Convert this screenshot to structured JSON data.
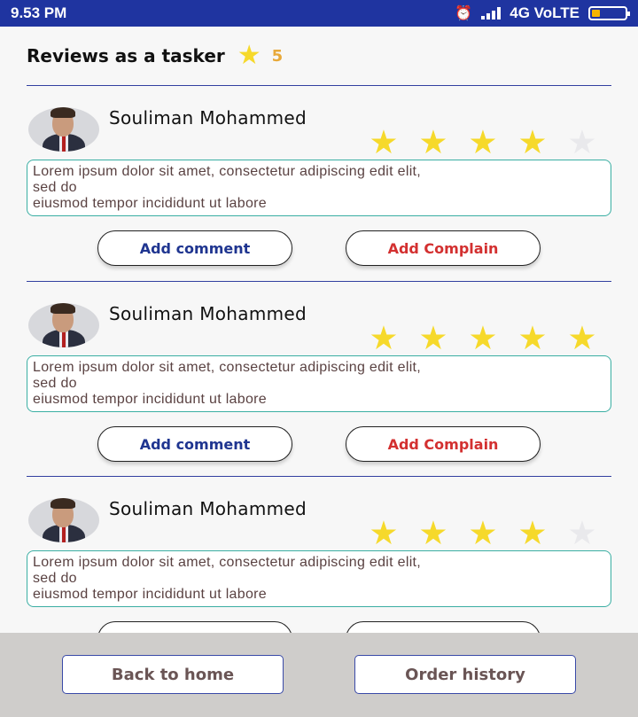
{
  "status_bar": {
    "time": "9.53 PM",
    "network": "4G VoLTE"
  },
  "header": {
    "title": "Reviews as a tasker",
    "rating": "5"
  },
  "reviews": [
    {
      "name": "Souliman Mohammed",
      "stars": 4,
      "comment_line1": "Lorem ipsum dolor sit amet, consectetur adipiscing edit elit,",
      "comment_line2": "sed do",
      "comment_line3": "eiusmod tempor incididunt ut labore",
      "comment_button": "Add comment",
      "complain_button": "Add Complain"
    },
    {
      "name": "Souliman Mohammed",
      "stars": 5,
      "comment_line1": "Lorem ipsum dolor sit amet, consectetur adipiscing edit elit,",
      "comment_line2": "sed do",
      "comment_line3": "eiusmod tempor incididunt ut labore",
      "comment_button": "Add comment",
      "complain_button": "Add Complain"
    },
    {
      "name": "Souliman Mohammed",
      "stars": 4,
      "comment_line1": "Lorem ipsum dolor sit amet, consectetur adipiscing edit elit,",
      "comment_line2": "sed do",
      "comment_line3": "eiusmod tempor incididunt ut labore",
      "comment_button": "Add comment",
      "complain_button": "Add Complain"
    }
  ],
  "bottom_nav": {
    "back_label": "Back to home",
    "history_label": "Order history"
  },
  "colors": {
    "status_bar": "#1f34a0",
    "star_on": "#f6d92b",
    "star_off": "#e9e9ec",
    "comment_button": "#1f3590",
    "complain_button": "#d33030",
    "comment_border": "#3aaea3"
  }
}
